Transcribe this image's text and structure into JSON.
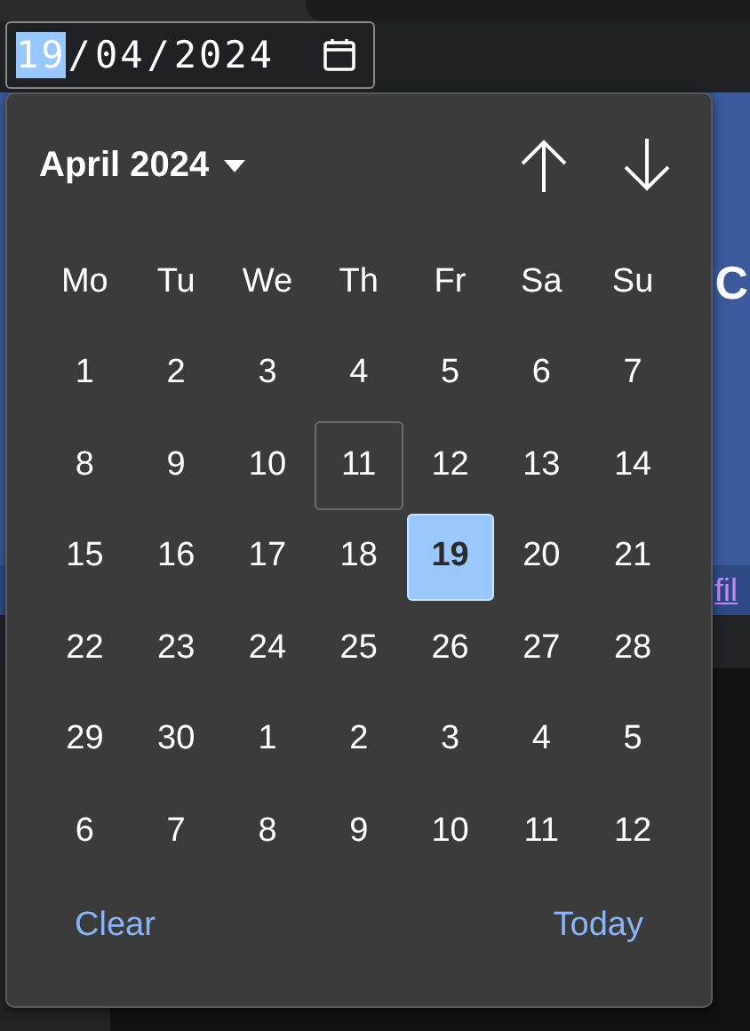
{
  "date_input": {
    "segments": [
      {
        "text": "19",
        "selected": true
      },
      {
        "text": "/",
        "selected": false
      },
      {
        "text": "04",
        "selected": false
      },
      {
        "text": "/",
        "selected": false
      },
      {
        "text": "2024",
        "selected": false
      }
    ]
  },
  "background": {
    "heading": "C",
    "link": "fil"
  },
  "calendar": {
    "month_label": "April 2024",
    "weekdays": [
      "Mo",
      "Tu",
      "We",
      "Th",
      "Fr",
      "Sa",
      "Su"
    ],
    "weeks": [
      [
        {
          "label": "1",
          "selected": false,
          "today": false
        },
        {
          "label": "2",
          "selected": false,
          "today": false
        },
        {
          "label": "3",
          "selected": false,
          "today": false
        },
        {
          "label": "4",
          "selected": false,
          "today": false
        },
        {
          "label": "5",
          "selected": false,
          "today": false
        },
        {
          "label": "6",
          "selected": false,
          "today": false
        },
        {
          "label": "7",
          "selected": false,
          "today": false
        }
      ],
      [
        {
          "label": "8",
          "selected": false,
          "today": false
        },
        {
          "label": "9",
          "selected": false,
          "today": false
        },
        {
          "label": "10",
          "selected": false,
          "today": false
        },
        {
          "label": "11",
          "selected": false,
          "today": true
        },
        {
          "label": "12",
          "selected": false,
          "today": false
        },
        {
          "label": "13",
          "selected": false,
          "today": false
        },
        {
          "label": "14",
          "selected": false,
          "today": false
        }
      ],
      [
        {
          "label": "15",
          "selected": false,
          "today": false
        },
        {
          "label": "16",
          "selected": false,
          "today": false
        },
        {
          "label": "17",
          "selected": false,
          "today": false
        },
        {
          "label": "18",
          "selected": false,
          "today": false
        },
        {
          "label": "19",
          "selected": true,
          "today": false
        },
        {
          "label": "20",
          "selected": false,
          "today": false
        },
        {
          "label": "21",
          "selected": false,
          "today": false
        }
      ],
      [
        {
          "label": "22",
          "selected": false,
          "today": false
        },
        {
          "label": "23",
          "selected": false,
          "today": false
        },
        {
          "label": "24",
          "selected": false,
          "today": false
        },
        {
          "label": "25",
          "selected": false,
          "today": false
        },
        {
          "label": "26",
          "selected": false,
          "today": false
        },
        {
          "label": "27",
          "selected": false,
          "today": false
        },
        {
          "label": "28",
          "selected": false,
          "today": false
        }
      ],
      [
        {
          "label": "29",
          "selected": false,
          "today": false
        },
        {
          "label": "30",
          "selected": false,
          "today": false
        },
        {
          "label": "1",
          "selected": false,
          "today": false
        },
        {
          "label": "2",
          "selected": false,
          "today": false
        },
        {
          "label": "3",
          "selected": false,
          "today": false
        },
        {
          "label": "4",
          "selected": false,
          "today": false
        },
        {
          "label": "5",
          "selected": false,
          "today": false
        }
      ],
      [
        {
          "label": "6",
          "selected": false,
          "today": false
        },
        {
          "label": "7",
          "selected": false,
          "today": false
        },
        {
          "label": "8",
          "selected": false,
          "today": false
        },
        {
          "label": "9",
          "selected": false,
          "today": false
        },
        {
          "label": "10",
          "selected": false,
          "today": false
        },
        {
          "label": "11",
          "selected": false,
          "today": false
        },
        {
          "label": "12",
          "selected": false,
          "today": false
        }
      ]
    ],
    "footer": {
      "clear": "Clear",
      "today": "Today"
    }
  }
}
